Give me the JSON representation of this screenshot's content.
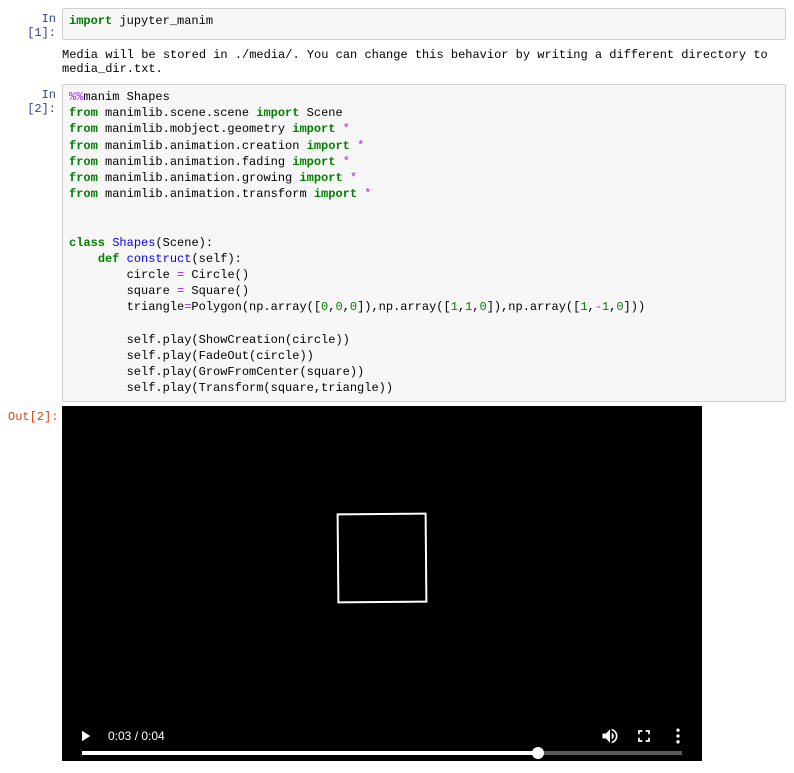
{
  "cells": {
    "c1": {
      "prompt": "In [1]:",
      "code_html": "<span class=\"kw\">import</span> jupyter_manim",
      "output": "Media will be stored in ./media/. You can change this behavior by writing a different directory to media_dir.txt."
    },
    "c2": {
      "prompt": "In [2]:",
      "code_html": "<span class=\"magic\">%%</span>manim Shapes\n<span class=\"kw\">from</span> manimlib.scene.scene <span class=\"kw\">import</span> Scene\n<span class=\"kw\">from</span> manimlib.mobject.geometry <span class=\"kw\">import</span> <span class=\"op\">*</span>\n<span class=\"kw\">from</span> manimlib.animation.creation <span class=\"kw\">import</span> <span class=\"op\">*</span>\n<span class=\"kw\">from</span> manimlib.animation.fading <span class=\"kw\">import</span> <span class=\"op\">*</span>\n<span class=\"kw\">from</span> manimlib.animation.growing <span class=\"kw\">import</span> <span class=\"op\">*</span>\n<span class=\"kw\">from</span> manimlib.animation.transform <span class=\"kw\">import</span> <span class=\"op\">*</span>\n\n\n<span class=\"kw\">class</span> <span class=\"cls\">Shapes</span>(Scene):\n    <span class=\"kw\">def</span> <span class=\"def\">construct</span>(self):\n        circle <span class=\"op\">=</span> Circle()\n        square <span class=\"op\">=</span> Square()\n        triangle<span class=\"op\">=</span>Polygon(np.array([<span class=\"num\">0</span>,<span class=\"num\">0</span>,<span class=\"num\">0</span>]),np.array([<span class=\"num\">1</span>,<span class=\"num\">1</span>,<span class=\"num\">0</span>]),np.array([<span class=\"num\">1</span>,<span class=\"op\">-</span><span class=\"num\">1</span>,<span class=\"num\">0</span>]))\n\n        self.play(ShowCreation(circle))\n        self.play(FadeOut(circle))\n        self.play(GrowFromCenter(square))\n        self.play(Transform(square,triangle))",
      "out_prompt": "Out[2]:"
    }
  },
  "video": {
    "time": "0:03 / 0:04",
    "progress_pct": 76
  }
}
